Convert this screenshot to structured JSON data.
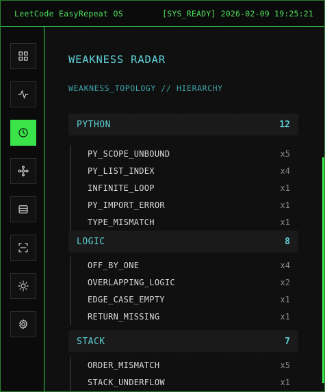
{
  "topbar": {
    "brand": "LeetCode EasyRepeat OS",
    "status": "[SYS_READY] 2026-02-09 19:25:21"
  },
  "sidebar": {
    "items": [
      {
        "icon": "grid-icon",
        "active": false
      },
      {
        "icon": "activity-icon",
        "active": false
      },
      {
        "icon": "clock-icon",
        "active": true
      },
      {
        "icon": "network-icon",
        "active": false
      },
      {
        "icon": "database-icon",
        "active": false
      },
      {
        "icon": "scan-icon",
        "active": false
      },
      {
        "icon": "sun-icon",
        "active": false
      },
      {
        "icon": "gear-icon",
        "active": false
      }
    ]
  },
  "main": {
    "title": "WEAKNESS RADAR",
    "subtitle": "WEAKNESS_TOPOLOGY // HIERARCHY",
    "groups": [
      {
        "name": "PYTHON",
        "count": "12",
        "items": [
          {
            "name": "PY_SCOPE_UNBOUND",
            "count": "x5"
          },
          {
            "name": "PY_LIST_INDEX",
            "count": "x4"
          },
          {
            "name": "INFINITE_LOOP",
            "count": "x1"
          },
          {
            "name": "PY_IMPORT_ERROR",
            "count": "x1"
          },
          {
            "name": "TYPE_MISMATCH",
            "count": "x1"
          }
        ]
      },
      {
        "name": "LOGIC",
        "count": "8",
        "items": [
          {
            "name": "OFF_BY_ONE",
            "count": "x4"
          },
          {
            "name": "OVERLAPPING_LOGIC",
            "count": "x2"
          },
          {
            "name": "EDGE_CASE_EMPTY",
            "count": "x1"
          },
          {
            "name": "RETURN_MISSING",
            "count": "x1"
          }
        ]
      },
      {
        "name": "STACK",
        "count": "7",
        "items": [
          {
            "name": "ORDER_MISMATCH",
            "count": "x5"
          },
          {
            "name": "STACK_UNDERFLOW",
            "count": "x1"
          }
        ]
      }
    ]
  },
  "colors": {
    "accent_green": "#3ae34a",
    "accent_cyan": "#5fd0d6"
  }
}
